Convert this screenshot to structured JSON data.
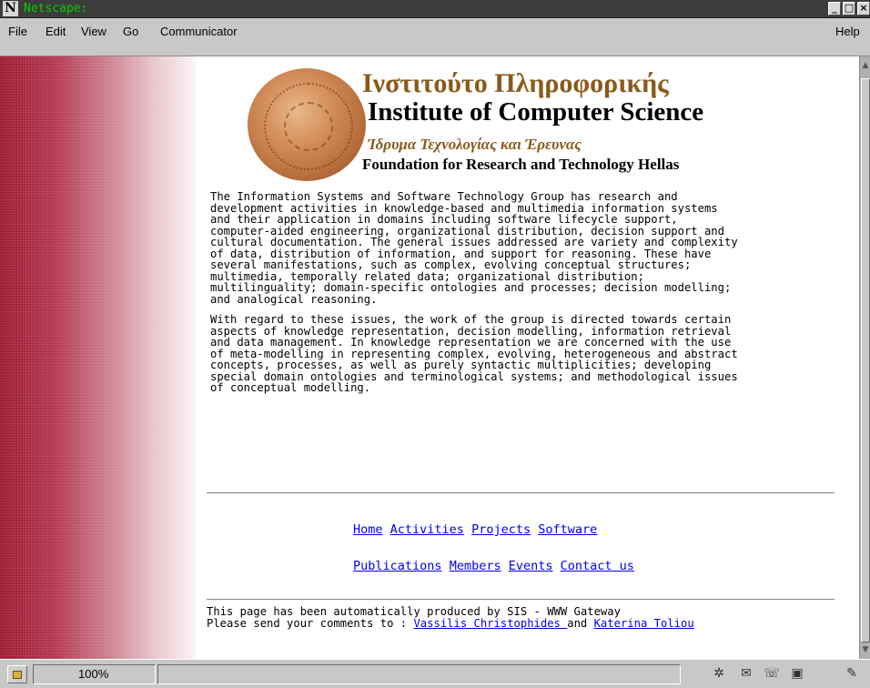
{
  "window": {
    "title": "Netscape:",
    "app_letter": "N"
  },
  "menubar": {
    "file": "File",
    "edit": "Edit",
    "view": "View",
    "go": "Go",
    "communicator": "Communicator",
    "help": "Help"
  },
  "header": {
    "greek_title": "Ινστιτούτο Πληροφορικής",
    "english_title": "Institute of Computer Science",
    "greek_subtitle": "Ίδρυμα Τεχνολογίας και Έρευνας",
    "english_subtitle": "Foundation for Research and Technology Hellas"
  },
  "content": {
    "paragraph1": "The Information Systems and Software Technology Group has research and\ndevelopment activities in knowledge-based and multimedia information systems\nand their application in domains including software lifecycle support,\ncomputer-aided engineering, organizational distribution, decision support and\ncultural documentation. The general issues addressed are variety and complexity\nof data, distribution of information, and support for reasoning. These have\nseveral manifestations, such as complex, evolving conceptual structures;\nmultimedia, temporally related data; organizational distribution;\nmultilinguality; domain-specific ontologies and processes; decision modelling;\nand analogical reasoning.",
    "paragraph2": "With regard to these issues, the work of the group is directed towards certain\naspects of knowledge representation, decision modelling, information retrieval\nand data management. In knowledge representation we are concerned with the use\nof meta-modelling in representing complex, evolving, heterogeneous and abstract\nconcepts, processes, as well as purely syntactic multiplicities; developing\nspecial domain ontologies and terminological systems; and methodological issues\nof conceptual modelling."
  },
  "nav": {
    "home": "Home",
    "activities": "Activities",
    "projects": "Projects",
    "software": "Software",
    "publications": "Publications",
    "members": "Members",
    "events": "Events",
    "contact": "Contact us"
  },
  "footer": {
    "line1": "This page has been automatically produced by SIS - WWW Gateway",
    "line2_prefix": "Please send your comments to : ",
    "contact1": "Vassilis Christophides ",
    "and": "and ",
    "contact2": "Katerina Toliou "
  },
  "statusbar": {
    "zoom": "100%"
  }
}
